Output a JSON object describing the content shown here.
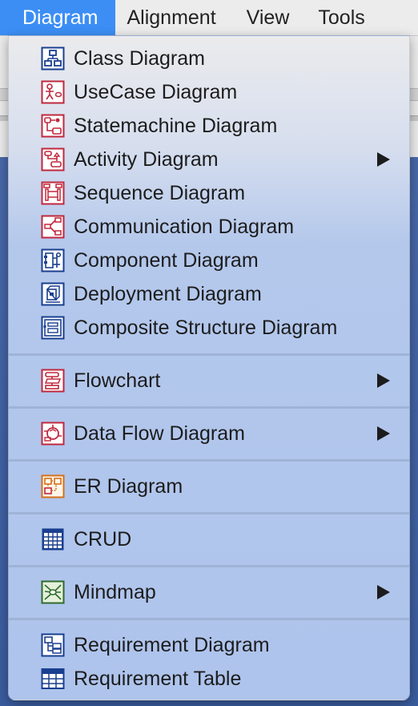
{
  "menubar": {
    "items": [
      "Diagram",
      "Alignment",
      "View",
      "Tools"
    ]
  },
  "menu": {
    "items": [
      {
        "label": "Class Diagram",
        "icon": "class-diagram-icon",
        "submenu": false
      },
      {
        "label": "UseCase Diagram",
        "icon": "usecase-diagram-icon",
        "submenu": false
      },
      {
        "label": "Statemachine Diagram",
        "icon": "statemachine-diagram-icon",
        "submenu": false
      },
      {
        "label": "Activity Diagram",
        "icon": "activity-diagram-icon",
        "submenu": true
      },
      {
        "label": "Sequence Diagram",
        "icon": "sequence-diagram-icon",
        "submenu": false
      },
      {
        "label": "Communication Diagram",
        "icon": "communication-diagram-icon",
        "submenu": false
      },
      {
        "label": "Component Diagram",
        "icon": "component-diagram-icon",
        "submenu": false
      },
      {
        "label": "Deployment Diagram",
        "icon": "deployment-diagram-icon",
        "submenu": false
      },
      {
        "label": "Composite Structure Diagram",
        "icon": "composite-structure-diagram-icon",
        "submenu": false
      },
      {
        "label": "Flowchart",
        "icon": "flowchart-icon",
        "submenu": true
      },
      {
        "label": "Data Flow Diagram",
        "icon": "data-flow-diagram-icon",
        "submenu": true
      },
      {
        "label": "ER Diagram",
        "icon": "er-diagram-icon",
        "submenu": false
      },
      {
        "label": "CRUD",
        "icon": "crud-table-icon",
        "submenu": false
      },
      {
        "label": "Mindmap",
        "icon": "mindmap-icon",
        "submenu": true
      },
      {
        "label": "Requirement Diagram",
        "icon": "requirement-diagram-icon",
        "submenu": false
      },
      {
        "label": "Requirement Table",
        "icon": "requirement-table-icon",
        "submenu": false
      }
    ]
  },
  "colors": {
    "menubar_highlight": "#3c8ef5",
    "icon_blue": "#1a3f8f",
    "icon_red": "#c0283e",
    "icon_orange": "#d4701c",
    "icon_green": "#2f6b2a"
  }
}
